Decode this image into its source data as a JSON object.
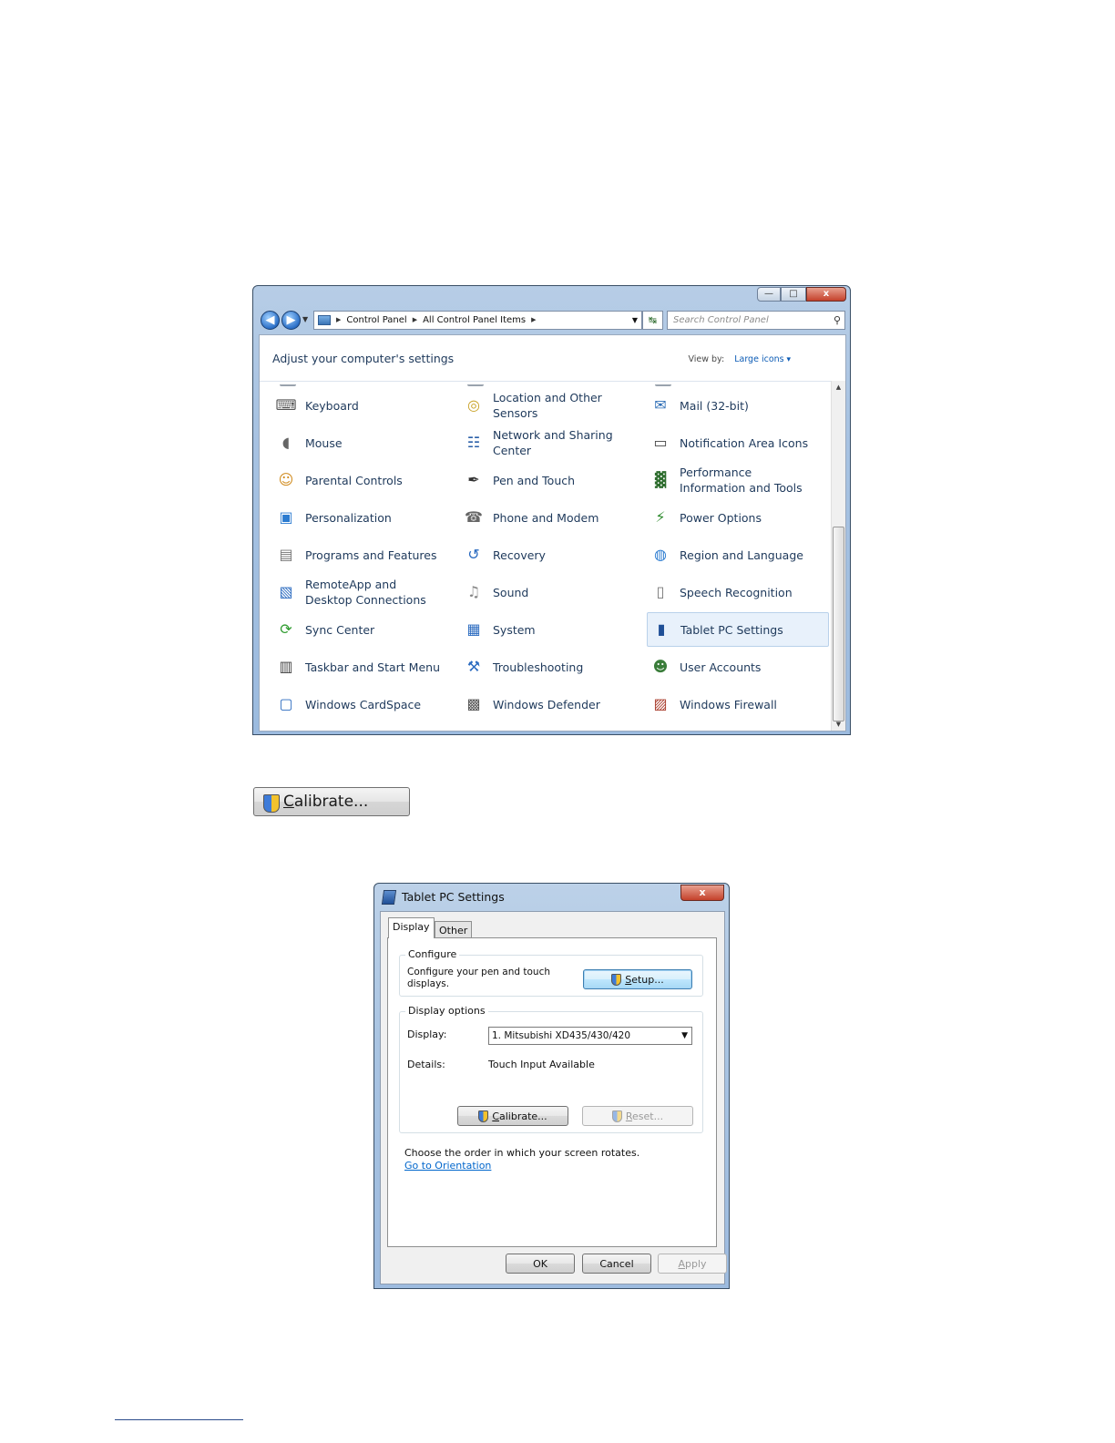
{
  "control_panel": {
    "caption_buttons": {
      "minimize": "—",
      "maximize": "□",
      "close": "x"
    },
    "address": {
      "breadcrumbs": [
        "Control Panel",
        "All Control Panel Items"
      ],
      "search_placeholder": "Search Control Panel"
    },
    "header": "Adjust your computer's settings",
    "view_by_label": "View by:",
    "view_by_value": "Large icons",
    "items": [
      {
        "label": "Keyboard",
        "icon": "keyboard-icon"
      },
      {
        "label": "Location and Other Sensors",
        "icon": "location-sensor-icon"
      },
      {
        "label": "Mail (32-bit)",
        "icon": "mail-icon"
      },
      {
        "label": "Mouse",
        "icon": "mouse-icon"
      },
      {
        "label": "Network and Sharing Center",
        "icon": "network-icon"
      },
      {
        "label": "Notification Area Icons",
        "icon": "notification-area-icon"
      },
      {
        "label": "Parental Controls",
        "icon": "parental-controls-icon"
      },
      {
        "label": "Pen and Touch",
        "icon": "pen-icon"
      },
      {
        "label": "Performance Information and Tools",
        "icon": "performance-icon"
      },
      {
        "label": "Personalization",
        "icon": "personalization-icon"
      },
      {
        "label": "Phone and Modem",
        "icon": "phone-icon"
      },
      {
        "label": "Power Options",
        "icon": "power-icon"
      },
      {
        "label": "Programs and Features",
        "icon": "programs-icon"
      },
      {
        "label": "Recovery",
        "icon": "recovery-icon"
      },
      {
        "label": "Region and Language",
        "icon": "globe-icon"
      },
      {
        "label": "RemoteApp and Desktop Connections",
        "icon": "remoteapp-icon"
      },
      {
        "label": "Sound",
        "icon": "speaker-icon"
      },
      {
        "label": "Speech Recognition",
        "icon": "microphone-icon"
      },
      {
        "label": "Sync Center",
        "icon": "sync-icon"
      },
      {
        "label": "System",
        "icon": "system-icon"
      },
      {
        "label": "Tablet PC Settings",
        "icon": "tablet-icon",
        "selected": true
      },
      {
        "label": "Taskbar and Start Menu",
        "icon": "taskbar-icon"
      },
      {
        "label": "Troubleshooting",
        "icon": "troubleshooting-icon"
      },
      {
        "label": "User Accounts",
        "icon": "users-icon"
      },
      {
        "label": "Windows CardSpace",
        "icon": "cardspace-icon"
      },
      {
        "label": "Windows Defender",
        "icon": "defender-icon"
      },
      {
        "label": "Windows Firewall",
        "icon": "firewall-icon"
      }
    ]
  },
  "calibrate_standalone": {
    "label_underlined": "C",
    "label_rest": "alibrate..."
  },
  "tablet_pc_settings": {
    "title": "Tablet PC Settings",
    "close": "x",
    "tabs": [
      "Display",
      "Other"
    ],
    "configure": {
      "title": "Configure",
      "text": "Configure your pen and touch displays.",
      "setup_underlined": "S",
      "setup_rest": "etup..."
    },
    "display_options": {
      "title": "Display options",
      "display_label": "Display:",
      "display_value": "1. Mitsubishi XD435/430/420",
      "details_label": "Details:",
      "details_value": "Touch Input Available",
      "calibrate_underlined": "C",
      "calibrate_rest": "alibrate...",
      "reset_underlined": "R",
      "reset_rest": "eset..."
    },
    "orientation_text": "Choose the order in which your screen rotates.",
    "orientation_link": "Go to Orientation",
    "buttons": {
      "ok": "OK",
      "cancel": "Cancel",
      "apply_underlined": "A",
      "apply_rest": "pply"
    }
  }
}
